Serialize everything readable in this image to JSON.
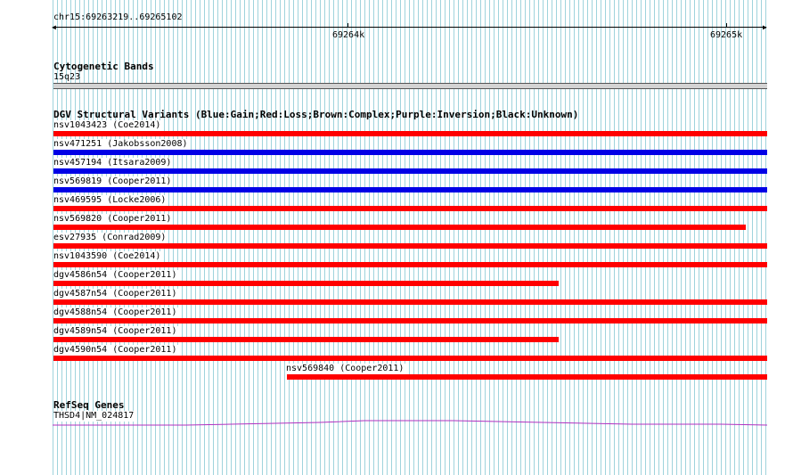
{
  "browser": {
    "region": "chr15:69263219..69265102",
    "ticks": [
      {
        "label": "69264k"
      },
      {
        "label": "69265k"
      }
    ]
  },
  "tracks": {
    "cytoband": {
      "title": "Cytogenetic Bands",
      "band_label": "15q23",
      "band_color": "#d3d3d3"
    },
    "dgv": {
      "title": "DGV Structural Variants (Blue:Gain;Red:Loss;Brown:Complex;Purple:Inversion;Black:Unknown)",
      "colors": {
        "gain": "#0000e6",
        "loss": "#ff0000"
      },
      "variants": [
        {
          "label": "nsv1043423 (Coe2014)",
          "type": "loss"
        },
        {
          "label": "nsv471251 (Jakobsson2008)",
          "type": "gain"
        },
        {
          "label": "nsv457194 (Itsara2009)",
          "type": "gain"
        },
        {
          "label": "nsv569819 (Cooper2011)",
          "type": "gain"
        },
        {
          "label": "nsv469595 (Locke2006)",
          "type": "loss"
        },
        {
          "label": "nsv569820 (Cooper2011)",
          "type": "loss"
        },
        {
          "label": "esv27935 (Conrad2009)",
          "type": "loss"
        },
        {
          "label": "nsv1043590 (Coe2014)",
          "type": "loss"
        },
        {
          "label": "dgv4586n54 (Cooper2011)",
          "type": "loss"
        },
        {
          "label": "dgv4587n54 (Cooper2011)",
          "type": "loss"
        },
        {
          "label": "dgv4588n54 (Cooper2011)",
          "type": "loss"
        },
        {
          "label": "dgv4589n54 (Cooper2011)",
          "type": "loss"
        },
        {
          "label": "dgv4590n54 (Cooper2011)",
          "type": "loss"
        },
        {
          "label": "nsv569840 (Cooper2011)",
          "type": "loss"
        }
      ]
    },
    "refseq": {
      "title": "RefSeq Genes",
      "gene_label": "THSD4|NM_024817",
      "gene_color": "#b030c0"
    }
  }
}
